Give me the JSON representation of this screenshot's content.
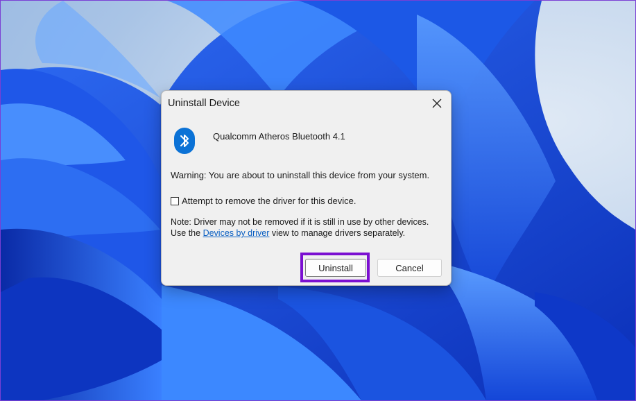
{
  "dialog": {
    "title": "Uninstall Device",
    "device_name": "Qualcomm Atheros Bluetooth 4.1",
    "warning": "Warning: You are about to uninstall this device from your system.",
    "checkbox_label": "Attempt to remove the driver for this device.",
    "checkbox_checked": false,
    "note_prefix": "Note: Driver may not be removed if it is still in use by other devices. Use the ",
    "note_link": "Devices by driver",
    "note_suffix": " view to manage drivers separately.",
    "uninstall_label": "Uninstall",
    "cancel_label": "Cancel"
  },
  "icons": {
    "device": "bluetooth-icon",
    "close": "close-icon"
  },
  "colors": {
    "bluetooth_blue": "#0b72d6",
    "highlight_purple": "#7b0fd1",
    "link_blue": "#0a5fc2",
    "dialog_bg": "#f0f0f0"
  }
}
